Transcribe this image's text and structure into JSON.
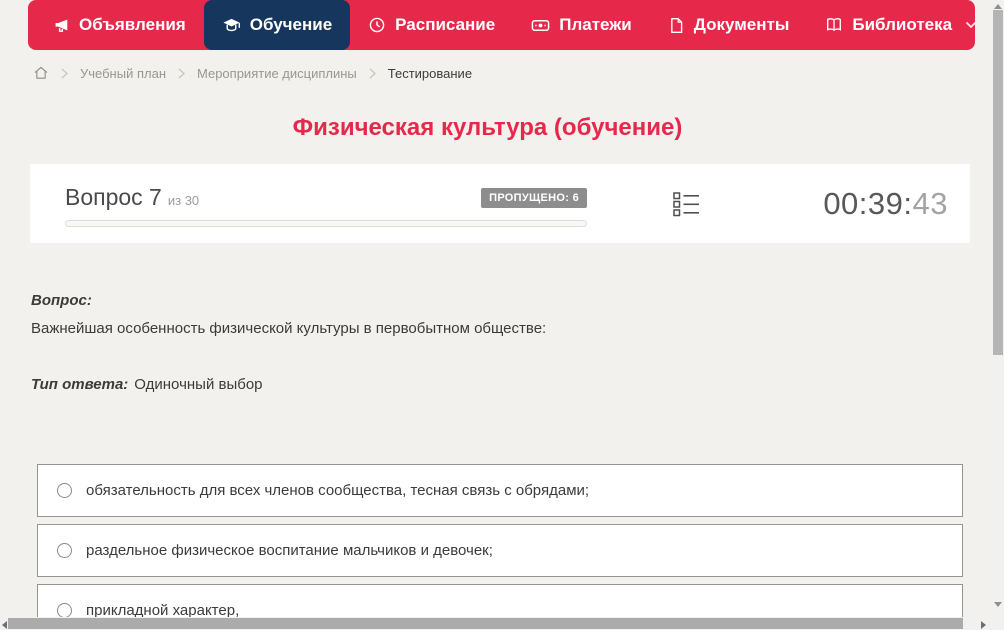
{
  "colors": {
    "page_background": "#f2f1ed",
    "nav_background": "#e6294b",
    "nav_active_background": "#17365e",
    "title_accent": "#e6294b",
    "badge_background": "#8d8d8d"
  },
  "nav": {
    "items": [
      {
        "label": "Объявления",
        "icon": "megaphone-icon",
        "active": false
      },
      {
        "label": "Обучение",
        "icon": "graduation-cap-icon",
        "active": true
      },
      {
        "label": "Расписание",
        "icon": "clock-icon",
        "active": false
      },
      {
        "label": "Платежи",
        "icon": "banknote-icon",
        "active": false
      },
      {
        "label": "Документы",
        "icon": "document-icon",
        "active": false
      },
      {
        "label": "Библиотека",
        "icon": "open-book-icon",
        "active": false,
        "has_dropdown": true
      }
    ]
  },
  "breadcrumb": {
    "items": [
      "Учебный план",
      "Мероприятие дисциплины",
      "Тестирование"
    ]
  },
  "page": {
    "title": "Физическая культура (обучение)"
  },
  "quiz": {
    "question_label": "Вопрос 7",
    "question_total": "из 30",
    "skipped_badge": "ПРОПУЩЕНО: 6",
    "progress_percent": 0,
    "timer_main": "00:39:",
    "timer_seconds": "43",
    "question_heading": "Вопрос:",
    "question_text": "Важнейшая особенность физической культуры в первобытном обществе:",
    "answer_type_label": "Тип ответа:",
    "answer_type_value": "Одиночный выбор",
    "options": [
      {
        "text": "обязательность для всех членов сообщества, тесная связь с обрядами;",
        "selected": false
      },
      {
        "text": "раздельное физическое воспитание мальчиков и девочек;",
        "selected": false
      },
      {
        "text": "прикладной характер,",
        "selected": false
      }
    ]
  }
}
